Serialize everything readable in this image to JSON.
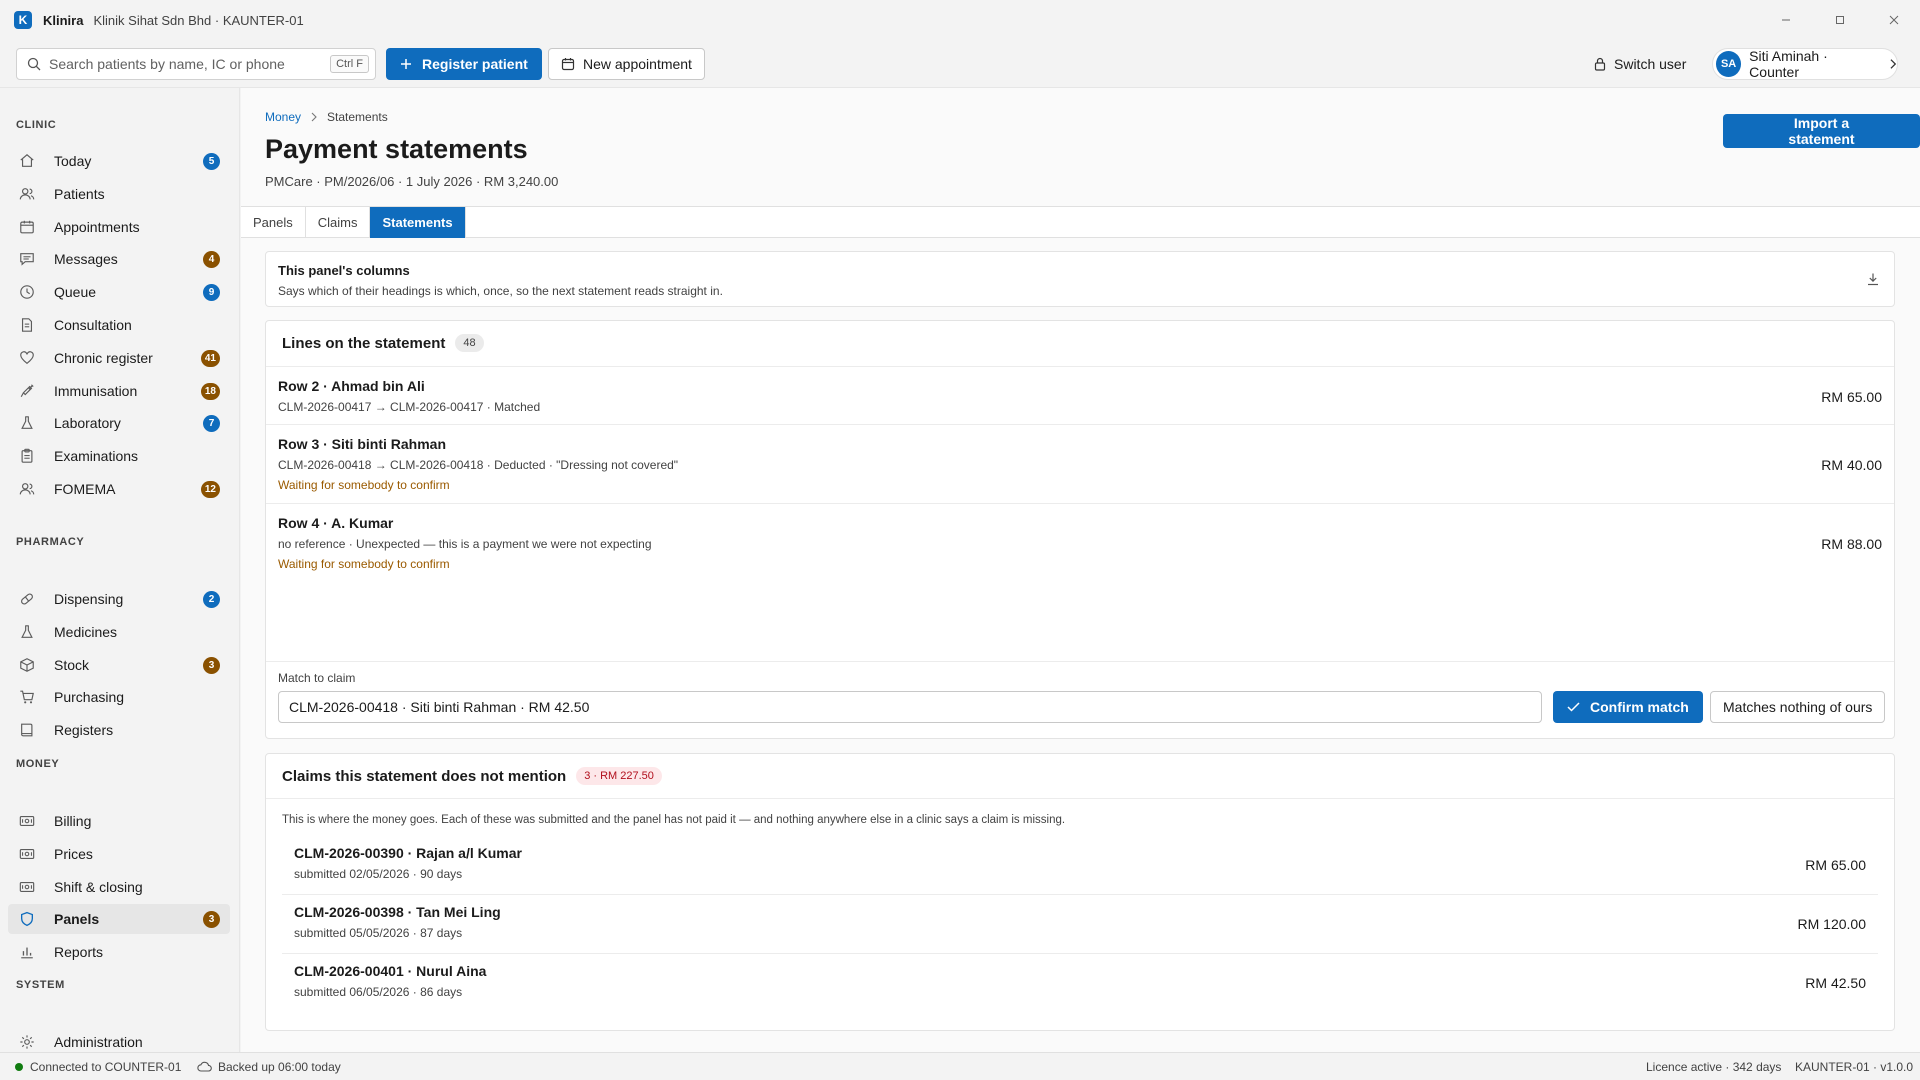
{
  "titlebar": {
    "app_logo": "K",
    "app_name": "Klinira",
    "org": "Klinik Sihat Sdn Bhd · KAUNTER-01"
  },
  "toolbar": {
    "search_placeholder": "Search patients by name, IC or phone",
    "search_shortcut": "Ctrl F",
    "register_label": "Register patient",
    "new_appointment_label": "New appointment",
    "switch_user_label": "Switch user",
    "user_initials": "SA",
    "user_label": "Siti Aminah · Counter"
  },
  "sidebar": {
    "clinic_heading": "CLINIC",
    "clinic_items": [
      {
        "label": "Today",
        "badge": "5",
        "badge_color": "blue",
        "icon": "home-icon"
      },
      {
        "label": "Patients",
        "badge": "",
        "icon": "people-icon"
      },
      {
        "label": "Appointments",
        "badge": "",
        "icon": "calendar-icon"
      },
      {
        "label": "Messages",
        "badge": "4",
        "badge_color": "amber",
        "icon": "chat-icon"
      },
      {
        "label": "Queue",
        "badge": "9",
        "badge_color": "blue",
        "icon": "clock-icon"
      },
      {
        "label": "Consultation",
        "badge": "",
        "icon": "document-icon"
      },
      {
        "label": "Chronic register",
        "badge": "41",
        "badge_color": "amber",
        "icon": "heart-icon"
      },
      {
        "label": "Immunisation",
        "badge": "18",
        "badge_color": "amber",
        "icon": "syringe-icon"
      },
      {
        "label": "Laboratory",
        "badge": "7",
        "badge_color": "blue",
        "icon": "flask-icon"
      },
      {
        "label": "Examinations",
        "badge": "",
        "icon": "clipboard-icon"
      },
      {
        "label": "FOMEMA",
        "badge": "12",
        "badge_color": "amber",
        "icon": "people-icon"
      }
    ],
    "pharmacy_heading": "PHARMACY",
    "pharmacy_items": [
      {
        "label": "Dispensing",
        "badge": "2",
        "badge_color": "blue",
        "icon": "pill-icon"
      },
      {
        "label": "Medicines",
        "badge": "",
        "icon": "flask-icon"
      },
      {
        "label": "Stock",
        "badge": "3",
        "badge_color": "amber",
        "icon": "box-icon"
      },
      {
        "label": "Purchasing",
        "badge": "",
        "icon": "cart-icon"
      },
      {
        "label": "Registers",
        "badge": "",
        "icon": "book-icon"
      }
    ],
    "money_heading": "MONEY",
    "money_items": [
      {
        "label": "Billing",
        "badge": "",
        "icon": "money-icon"
      },
      {
        "label": "Prices",
        "badge": "",
        "icon": "money-icon"
      },
      {
        "label": "Shift & closing",
        "badge": "",
        "icon": "money-icon"
      },
      {
        "label": "Panels",
        "badge": "3",
        "badge_color": "amber",
        "icon": "shield-icon",
        "active": true
      },
      {
        "label": "Reports",
        "badge": "",
        "icon": "chart-icon"
      }
    ],
    "system_heading": "SYSTEM",
    "system_items": [
      {
        "label": "Administration",
        "badge": "",
        "icon": "gear-icon"
      }
    ]
  },
  "page": {
    "breadcrumb_root": "Money",
    "breadcrumb_current": "Statements",
    "title": "Payment statements",
    "subtitle": "PMCare · PM/2026/06 · 1 July 2026 · RM 3,240.00",
    "import_label": "Import a statement",
    "tabs": [
      "Panels",
      "Claims",
      "Statements"
    ],
    "active_tab": "Statements"
  },
  "columns_card": {
    "title": "This panel's columns",
    "description": "Says which of their headings is which, once, so the next statement reads straight in."
  },
  "lines_card": {
    "title": "Lines on the statement",
    "count": "48",
    "rows": [
      {
        "title": "Row 2 · Ahmad bin Ali",
        "detail": "CLM-2026-00417 → CLM-2026-00417 · Matched",
        "status": "",
        "amount": "RM 65.00"
      },
      {
        "title": "Row 3 · Siti binti Rahman",
        "detail": "CLM-2026-00418 → CLM-2026-00418 · Deducted · \"Dressing not covered\"",
        "status": "Waiting for somebody to confirm",
        "amount": "RM 40.00"
      },
      {
        "title": "Row 4 · A. Kumar",
        "detail": "no reference · Unexpected — this is a payment we were not expecting",
        "status": "Waiting for somebody to confirm",
        "amount": "RM 88.00"
      }
    ],
    "match_label": "Match to claim",
    "match_value": "CLM-2026-00418 · Siti binti Rahman · RM 42.50",
    "confirm_label": "Confirm match",
    "nothing_label": "Matches nothing of ours"
  },
  "missing_card": {
    "title": "Claims this statement does not mention",
    "badge": "3 · RM 227.50",
    "description": "This is where the money goes. Each of these was submitted and the panel has not paid it — and nothing anywhere else in a clinic says a claim is missing.",
    "rows": [
      {
        "title": "CLM-2026-00390 · Rajan a/l Kumar",
        "detail": "submitted 02/05/2026 · 90 days",
        "amount": "RM 65.00"
      },
      {
        "title": "CLM-2026-00398 · Tan Mei Ling",
        "detail": "submitted 05/05/2026 · 87 days",
        "amount": "RM 120.00"
      },
      {
        "title": "CLM-2026-00401 · Nurul Aina",
        "detail": "submitted 06/05/2026 · 86 days",
        "amount": "RM 42.50"
      }
    ]
  },
  "statusbar": {
    "connection": "Connected to COUNTER-01",
    "backup": "Backed up 06:00 today",
    "licence": "Licence active · 342 days",
    "version": "KAUNTER-01 · v1.0.0"
  },
  "colors": {
    "accent": "#0f6cbd",
    "badge_amber": "#8a5100",
    "waiting_text": "#9a5a00",
    "online_dot": "#107c10",
    "danger_badge_bg": "#fde7e9"
  }
}
